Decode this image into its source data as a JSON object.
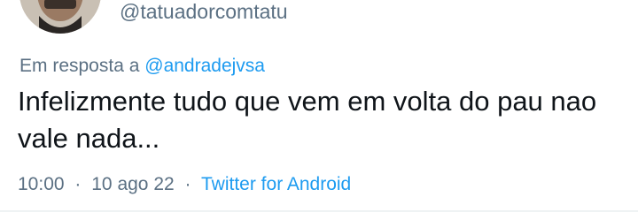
{
  "author": {
    "handle": "@tatuadorcomtatu"
  },
  "reply": {
    "prefix": "Em resposta a",
    "mention": "@andradejvsa"
  },
  "tweet": {
    "text": "Infelizmente tudo que vem em volta do pau nao vale nada...",
    "time": "10:00",
    "date": "10 ago 22",
    "source": "Twitter for Android",
    "separator": "·"
  },
  "colors": {
    "muted": "#5b7083",
    "link": "#1d9bf0",
    "text": "#0f1419"
  },
  "icons": {
    "avatar": "profile-photo"
  }
}
